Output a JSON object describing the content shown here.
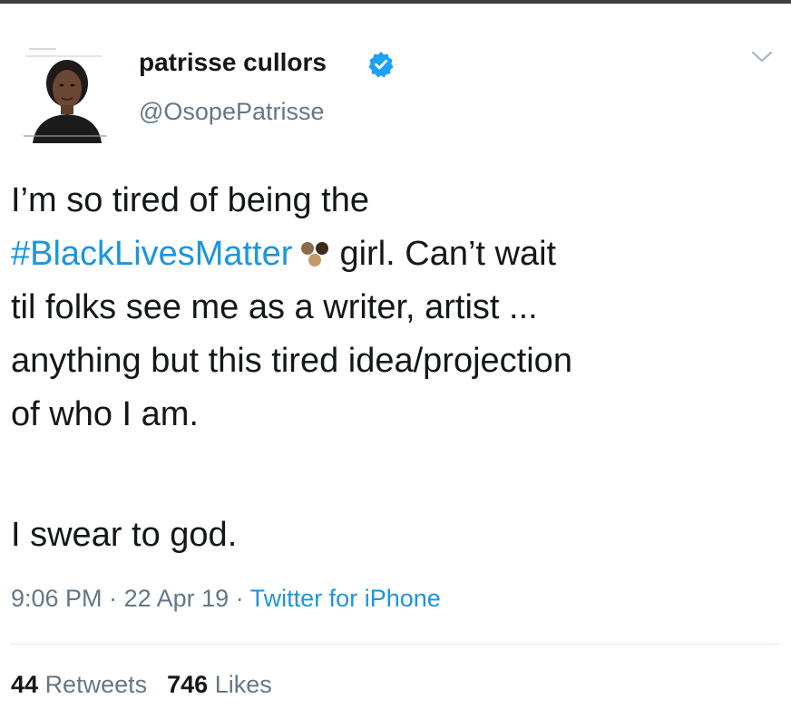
{
  "tweet": {
    "author": {
      "display_name": "patrisse cullors",
      "handle": "@OsopePatrisse",
      "verified": true,
      "avatar_icon": "avatar"
    },
    "body": {
      "line1": "I’m so tired of being the",
      "hashtag": "#BlackLivesMatter",
      "line2_rest": "girl. Can’t wait",
      "line3": "til folks see me as a writer, artist ...",
      "line4": "anything but this tired idea/projection",
      "line5": "of who I am.",
      "paragraph2": "I swear to god.",
      "emoji_icon": "three-dots-emoji-icon"
    },
    "meta": {
      "time": "9:06 PM",
      "separator": " · ",
      "date": "22 Apr 19",
      "source": "Twitter for iPhone"
    },
    "stats": {
      "retweets_count": "44",
      "retweets_label": "Retweets",
      "likes_count": "746",
      "likes_label": "Likes"
    }
  },
  "colors": {
    "link": "#1b95e0",
    "secondary_text": "#657786",
    "primary_text": "#14171a",
    "verified_badge": "#1da1f2",
    "divider": "#e1e8ed"
  }
}
